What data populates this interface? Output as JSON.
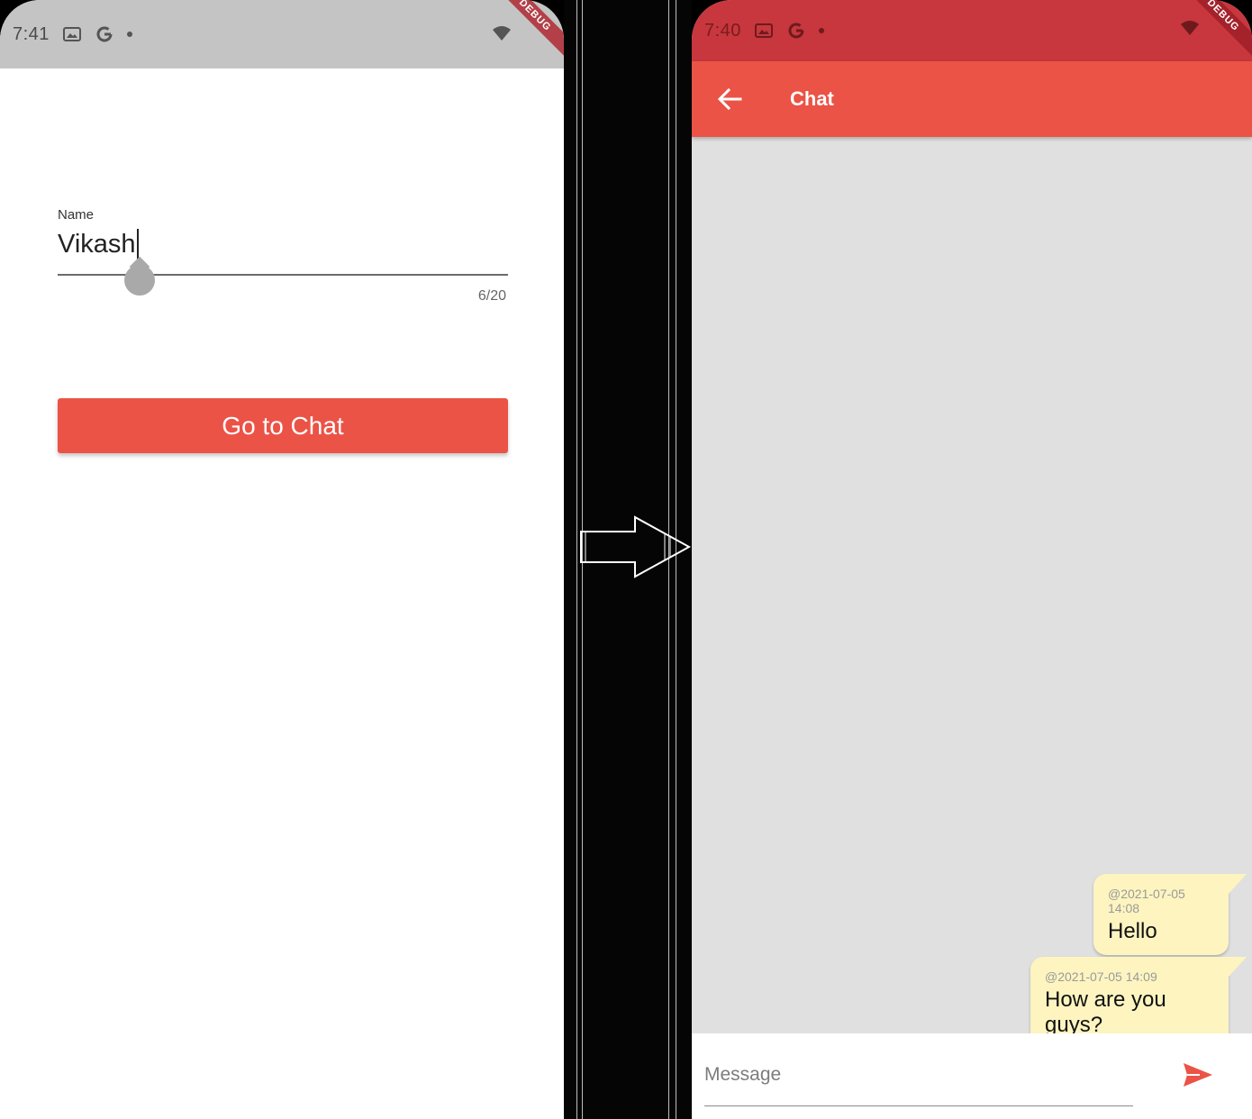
{
  "left_screen": {
    "status_time": "7:41",
    "debug_banner": "DEBUG",
    "name_field": {
      "label": "Name",
      "value": "Vikash",
      "counter": "6/20"
    },
    "go_button_label": "Go to Chat"
  },
  "right_screen": {
    "status_time": "7:40",
    "debug_banner": "DEBUG",
    "appbar": {
      "title": "Chat",
      "back_icon": "arrow-back-icon"
    },
    "messages": [
      {
        "timestamp": "@2021-07-05 14:08",
        "text": "Hello"
      },
      {
        "timestamp": "@2021-07-05 14:09",
        "text": "How are you guys?"
      }
    ],
    "composer": {
      "placeholder": "Message",
      "send_icon": "send-icon"
    }
  },
  "colors": {
    "accent": "#eb5346",
    "right_status_bar": "#c7373d",
    "left_status_bar": "#c4c4c4",
    "chat_background": "#e0e0e0",
    "bubble": "#fdf4c0",
    "debug_ribbon": "#a5222b"
  }
}
